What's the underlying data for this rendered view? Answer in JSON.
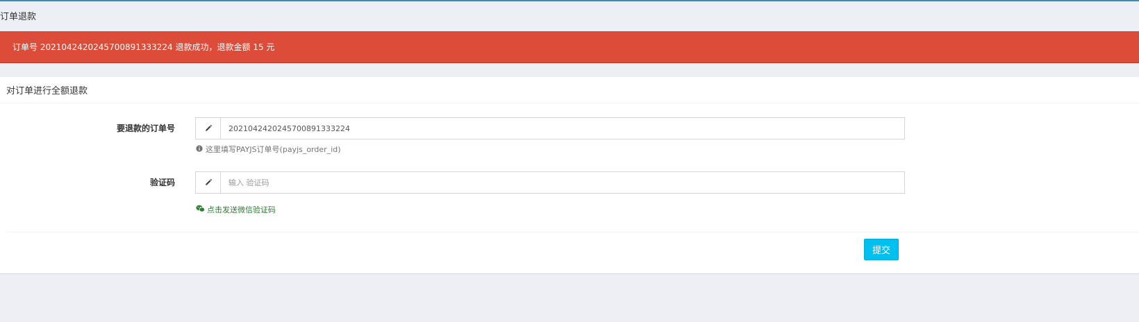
{
  "page": {
    "title": "订单退款"
  },
  "alert": {
    "message": "订单号 20210424202457008913332​24 退款成功，退款金额 15 元",
    "color": "#dd4b39"
  },
  "box": {
    "title": "对订单进行全额退款",
    "order_field": {
      "label": "要退款的订单号",
      "value": "2021042420245700891333224",
      "icon": "pencil-icon",
      "help_text": "这里填写PAYJS订单号(payjs_order_id)",
      "help_icon": "info-circle-icon"
    },
    "captcha_field": {
      "label": "验证码",
      "placeholder": "输入 验证码",
      "icon": "pencil-icon",
      "send_link": "点击发送微信验证码",
      "send_icon": "wechat-icon"
    },
    "submit_label": "提交",
    "accent_color": "#00c0ef"
  }
}
